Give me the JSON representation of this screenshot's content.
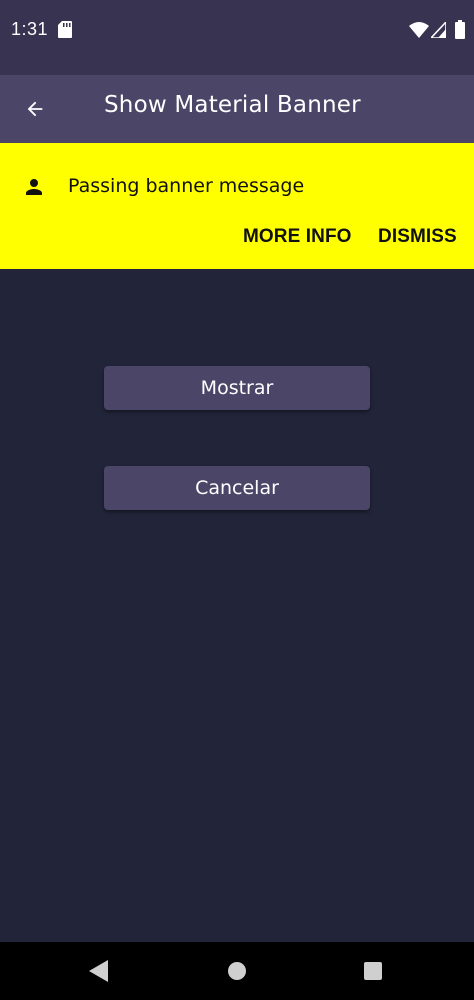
{
  "status_bar": {
    "time": "1:31",
    "icons": [
      "sd-card-icon",
      "wifi-icon",
      "signal-icon",
      "battery-icon"
    ]
  },
  "app_bar": {
    "title": "Show Material Banner",
    "back_icon": "arrow-back-icon"
  },
  "banner": {
    "icon": "person-icon",
    "message": "Passing banner message",
    "actions": {
      "more_info": "MORE INFO",
      "dismiss": "DISMISS"
    },
    "background_color": "#ffff00"
  },
  "buttons": {
    "show": "Mostrar",
    "cancel": "Cancelar"
  },
  "nav_bar": {
    "icons": [
      "nav-back-icon",
      "nav-home-icon",
      "nav-recents-icon"
    ]
  },
  "colors": {
    "background": "#22253a",
    "app_bar": "#4b4568",
    "status_bar": "#383351",
    "button": "#4b4568",
    "banner": "#ffff00"
  }
}
